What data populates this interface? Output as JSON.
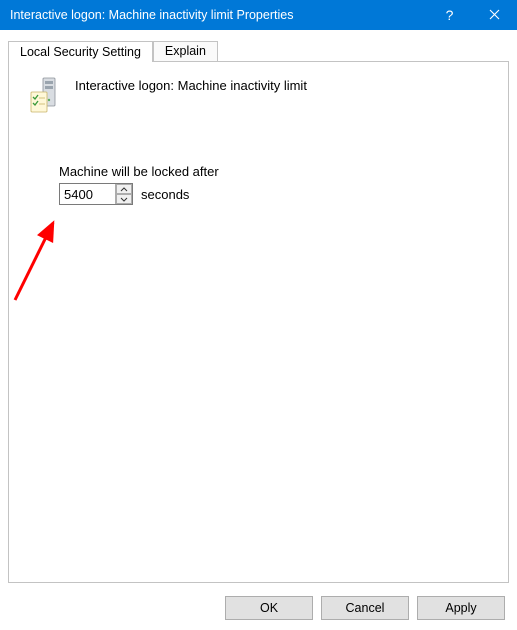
{
  "window": {
    "title": "Interactive logon: Machine inactivity limit Properties"
  },
  "tabs": {
    "local": "Local Security Setting",
    "explain": "Explain"
  },
  "policy": {
    "title": "Interactive logon: Machine inactivity limit"
  },
  "field": {
    "label": "Machine will be locked after",
    "value": "5400",
    "unit": "seconds"
  },
  "buttons": {
    "ok": "OK",
    "cancel": "Cancel",
    "apply": "Apply"
  }
}
